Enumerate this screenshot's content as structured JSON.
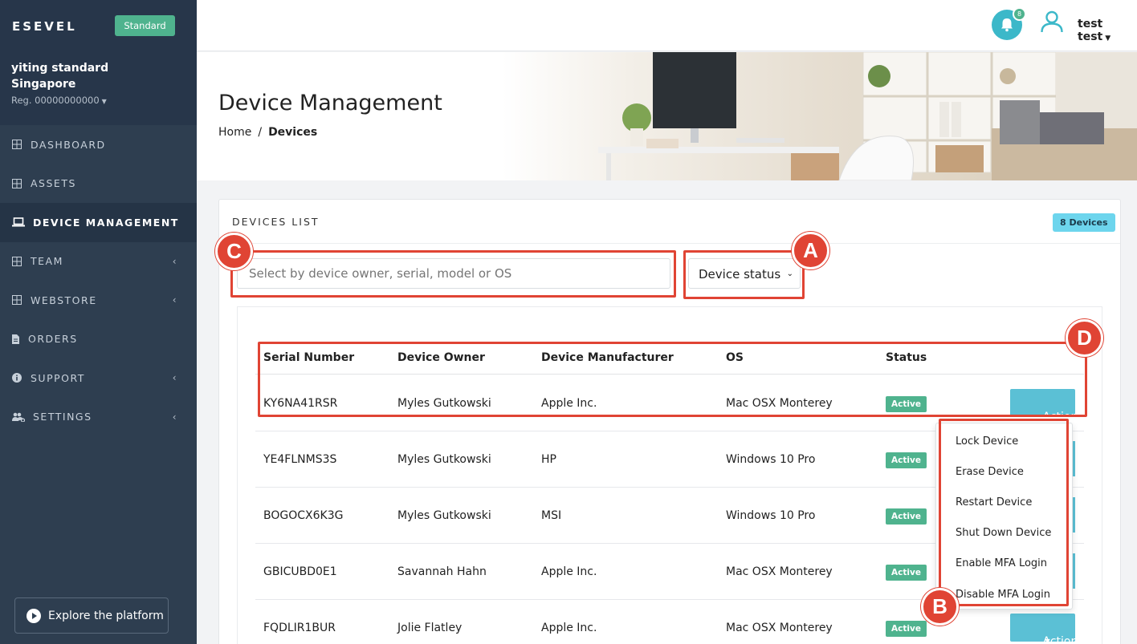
{
  "brand": {
    "logo": "ESEVEL",
    "plan": "Standard"
  },
  "company": {
    "name_line1": "yiting standard",
    "name_line2": "Singapore",
    "reg": "Reg. 00000000000"
  },
  "nav": [
    {
      "label": "DASHBOARD"
    },
    {
      "label": "ASSETS"
    },
    {
      "label": "DEVICE MANAGEMENT"
    },
    {
      "label": "TEAM"
    },
    {
      "label": "WEBSTORE"
    },
    {
      "label": "ORDERS"
    },
    {
      "label": "SUPPORT"
    },
    {
      "label": "SETTINGS"
    }
  ],
  "explore_label": "Explore the platform",
  "topbar": {
    "notification_count": "8",
    "user_name": "test test"
  },
  "header": {
    "title": "Device Management",
    "breadcrumb_home": "Home",
    "breadcrumb_sep": "/",
    "breadcrumb_current": "Devices"
  },
  "card": {
    "title": "DEVICES LIST",
    "count_badge": "8 Devices"
  },
  "filters": {
    "search_placeholder": "Select by device owner, serial, model or OS",
    "status_select": "Device status"
  },
  "table": {
    "headers": [
      "Serial Number",
      "Device Owner",
      "Device Manufacturer",
      "OS",
      "Status"
    ],
    "rows": [
      {
        "serial": "KY6NA41RSR",
        "owner": "Myles Gutkowski",
        "manufacturer": "Apple Inc.",
        "os": "Mac OSX Monterey",
        "status": "Active"
      },
      {
        "serial": "YE4FLNMS3S",
        "owner": "Myles Gutkowski",
        "manufacturer": "HP",
        "os": "Windows 10 Pro",
        "status": "Active"
      },
      {
        "serial": "BOGOCX6K3G",
        "owner": "Myles Gutkowski",
        "manufacturer": "MSI",
        "os": "Windows 10 Pro",
        "status": "Active"
      },
      {
        "serial": "GBICUBD0E1",
        "owner": "Savannah Hahn",
        "manufacturer": "Apple Inc.",
        "os": "Mac OSX Monterey",
        "status": "Active"
      },
      {
        "serial": "FQDLIR1BUR",
        "owner": "Jolie Flatley",
        "manufacturer": "Apple Inc.",
        "os": "Mac OSX Monterey",
        "status": "Active"
      }
    ],
    "action_label": "Action"
  },
  "action_menu": [
    "Lock Device",
    "Erase Device",
    "Restart Device",
    "Shut Down Device",
    "Enable MFA Login",
    "Disable MFA Login"
  ],
  "annotations": {
    "a": "A",
    "b": "B",
    "c": "C",
    "d": "D"
  },
  "colors": {
    "sidebar": "#2e3e50",
    "accent": "#5bc0d5",
    "success": "#4fb38e",
    "annotation": "#e04434"
  }
}
